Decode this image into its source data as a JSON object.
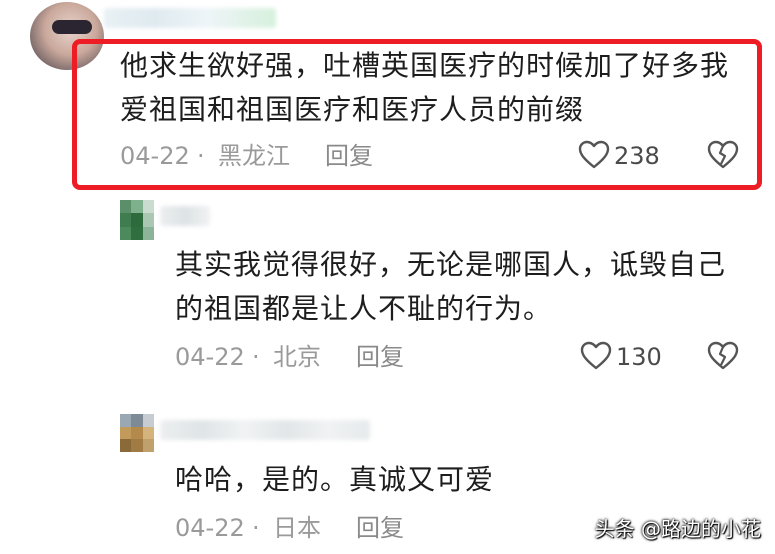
{
  "comments": [
    {
      "text": "他求生欲好强，吐槽英国医疗的时候加了好多我爱祖国和祖国医疗和医疗人员的前缀",
      "line1": "他求生欲好强，吐槽英国医疗的时候加了好多我",
      "line2": "爱祖国和祖国医疗和医疗人员的前缀",
      "date": "04-22",
      "location": "黑龙江",
      "separator": "·",
      "reply_label": "回复",
      "likes": "238",
      "highlighted": true
    },
    {
      "text": "其实我觉得很好，无论是哪国人，诋毁自己的祖国都是让人不耻的行为。",
      "line1": "其实我觉得很好，无论是哪国人，诋毁自己",
      "line2": "的祖国都是让人不耻的行为。",
      "date": "04-22",
      "location": "北京",
      "separator": "·",
      "reply_label": "回复",
      "likes": "130"
    },
    {
      "text": "哈哈，是的。真诚又可爱",
      "line1": "哈哈，是的。真诚又可爱",
      "date": "04-22",
      "location": "日本",
      "separator": "·",
      "reply_label": "回复"
    }
  ],
  "watermark": "头条 @路边的小花",
  "colors": {
    "highlight_border": "#ee1c25",
    "meta_text": "#9a9a9a"
  },
  "icons": [
    "heart-icon",
    "dislike-heart-icon"
  ]
}
